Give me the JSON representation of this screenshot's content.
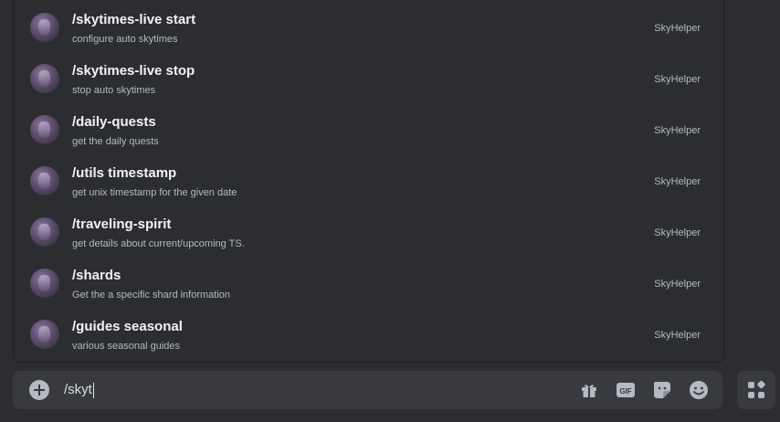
{
  "commands": [
    {
      "name": "/skytimes-live start",
      "description": "configure auto skytimes",
      "source": "SkyHelper"
    },
    {
      "name": "/skytimes-live stop",
      "description": "stop auto skytimes",
      "source": "SkyHelper"
    },
    {
      "name": "/daily-quests",
      "description": "get the daily quests",
      "source": "SkyHelper"
    },
    {
      "name": "/utils timestamp",
      "description": "get unix timestamp for the given date",
      "source": "SkyHelper"
    },
    {
      "name": "/traveling-spirit",
      "description": "get details about current/upcoming TS.",
      "source": "SkyHelper"
    },
    {
      "name": "/shards",
      "description": "Get the a specific shard information",
      "source": "SkyHelper"
    },
    {
      "name": "/guides seasonal",
      "description": "various seasonal guides",
      "source": "SkyHelper"
    }
  ],
  "chatbar": {
    "input_value": "/skyt",
    "gif_label": "GIF"
  },
  "icons": {
    "add": "plus-circle-icon",
    "gift": "gift-icon",
    "gif": "gif-icon",
    "sticker": "sticker-icon",
    "emoji": "emoji-icon",
    "apps": "apps-icon"
  },
  "colors": {
    "background": "#2b2d31",
    "chatbar": "#383a40",
    "text_primary": "#f2f3f5",
    "text_secondary": "#b5bac1"
  }
}
